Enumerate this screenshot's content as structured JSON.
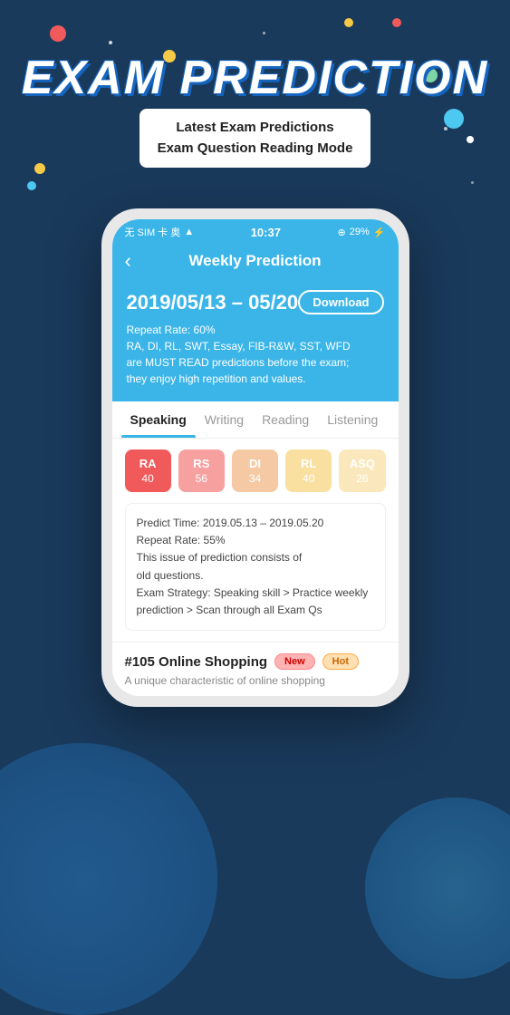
{
  "background": {
    "color": "#1a3a5c"
  },
  "title": {
    "main": "EXAM PREDICTION",
    "subtitle_line1": "Latest Exam Predictions",
    "subtitle_line2": "Exam Question Reading Mode"
  },
  "status_bar": {
    "carrier": "无 SIM 卡 奥",
    "time": "10:37",
    "battery": "29%"
  },
  "header": {
    "back_label": "‹",
    "title": "Weekly Prediction"
  },
  "info_section": {
    "date_range": "2019/05/13 – 05/20",
    "download_label": "Download",
    "line1": "Repeat Rate: 60%",
    "line2": "RA, DI, RL, SWT, Essay, FIB-R&W, SST, WFD",
    "line3": "are MUST READ predictions before the exam;",
    "line4": "they enjoy high repetition and values."
  },
  "tabs": [
    {
      "label": "Speaking",
      "active": true
    },
    {
      "label": "Writing",
      "active": false
    },
    {
      "label": "Reading",
      "active": false
    },
    {
      "label": "Listening",
      "active": false
    }
  ],
  "skill_buttons": [
    {
      "label": "RA",
      "num": "40",
      "style": "skill-ra"
    },
    {
      "label": "RS",
      "num": "56",
      "style": "skill-rs"
    },
    {
      "label": "DI",
      "num": "34",
      "style": "skill-di"
    },
    {
      "label": "RL",
      "num": "40",
      "style": "skill-rl"
    },
    {
      "label": "ASQ",
      "num": "26",
      "style": "skill-asq"
    }
  ],
  "prediction_box": {
    "line1": "Predict Time: 2019.05.13 – 2019.05.20",
    "line2": "Repeat Rate: 55%",
    "line3": "This issue of prediction consists of",
    "line4": "old questions.",
    "line5": "Exam Strategy: Speaking skill > Practice weekly",
    "line6": "prediction > Scan through all Exam Qs"
  },
  "item": {
    "title": "#105 Online Shopping",
    "badge_new": "New",
    "badge_hot": "Hot",
    "description": "A unique characteristic of online shopping"
  }
}
